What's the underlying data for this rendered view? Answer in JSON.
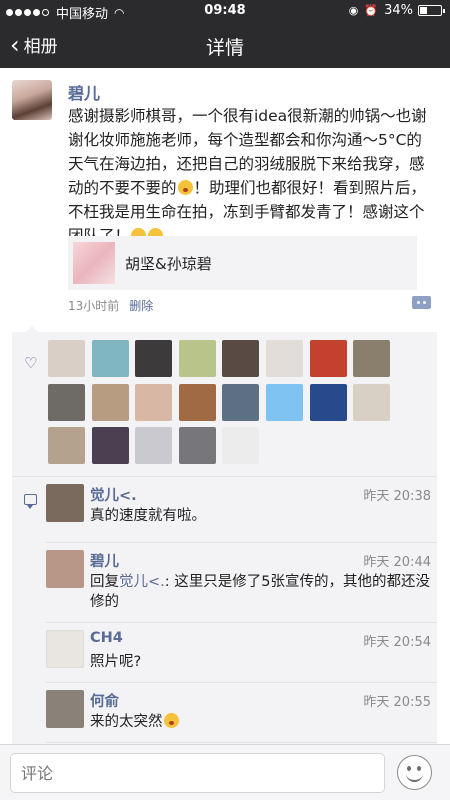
{
  "status_bar": {
    "carrier": "中国移动",
    "time": "09:48",
    "battery": "34%",
    "battery_level": 0.34
  },
  "nav": {
    "back_label": "相册",
    "title": "详情"
  },
  "post": {
    "author": "碧儿",
    "text": "感谢摄影师棋哥，一个很有idea很新潮的帅锅～也谢谢化妆师施施老师，每个造型都会和你沟通～5°C的天气在海边拍，还把自己的羽绒服脱下来给我穿，感动的不要不要的",
    "text_tail_1": "！助理们也都很好！看到照片后，不枉我是用生命在拍，冻到手臂都发青了！感谢这个团队了！",
    "shared_title": "胡坚&孙琼碧",
    "time": "13小时前",
    "delete_label": "删除"
  },
  "likes": {
    "avatar_colors": [
      "#d9cfc6",
      "#7fb6c2",
      "#3d3a3c",
      "#b9c48a",
      "#5a4a44",
      "#e2ddd8",
      "#c4422d",
      "#8a7f6d",
      "#6e6a66",
      "#b89c82",
      "#d8b8a5",
      "#a06a45",
      "#5d6f82",
      "#7ec3f1",
      "#274a8d",
      "#d8d0c4",
      "#b4a28e",
      "#4a4052",
      "#c9c9cf",
      "#77777b",
      "#ececec"
    ]
  },
  "comments": [
    {
      "name": "觉儿<.",
      "time": "昨天 20:38",
      "text": "真的速度就有啦。",
      "avatar_color": "#7a6a5d"
    },
    {
      "name": "碧儿",
      "time": "昨天 20:44",
      "reply_prefix": "回复",
      "reply_to": "觉儿<.",
      "text": ": 这里只是修了5张宣传的，其他的都还没修的",
      "avatar_color": "#b89788"
    },
    {
      "name": "CH4",
      "time": "昨天 20:54",
      "text": "照片呢?",
      "avatar_color": "#e9e6e1"
    },
    {
      "name": "何俞",
      "time": "昨天 20:55",
      "text": "来的太突然",
      "avatar_color": "#8a8278"
    }
  ],
  "bottom": {
    "placeholder": "评论"
  }
}
